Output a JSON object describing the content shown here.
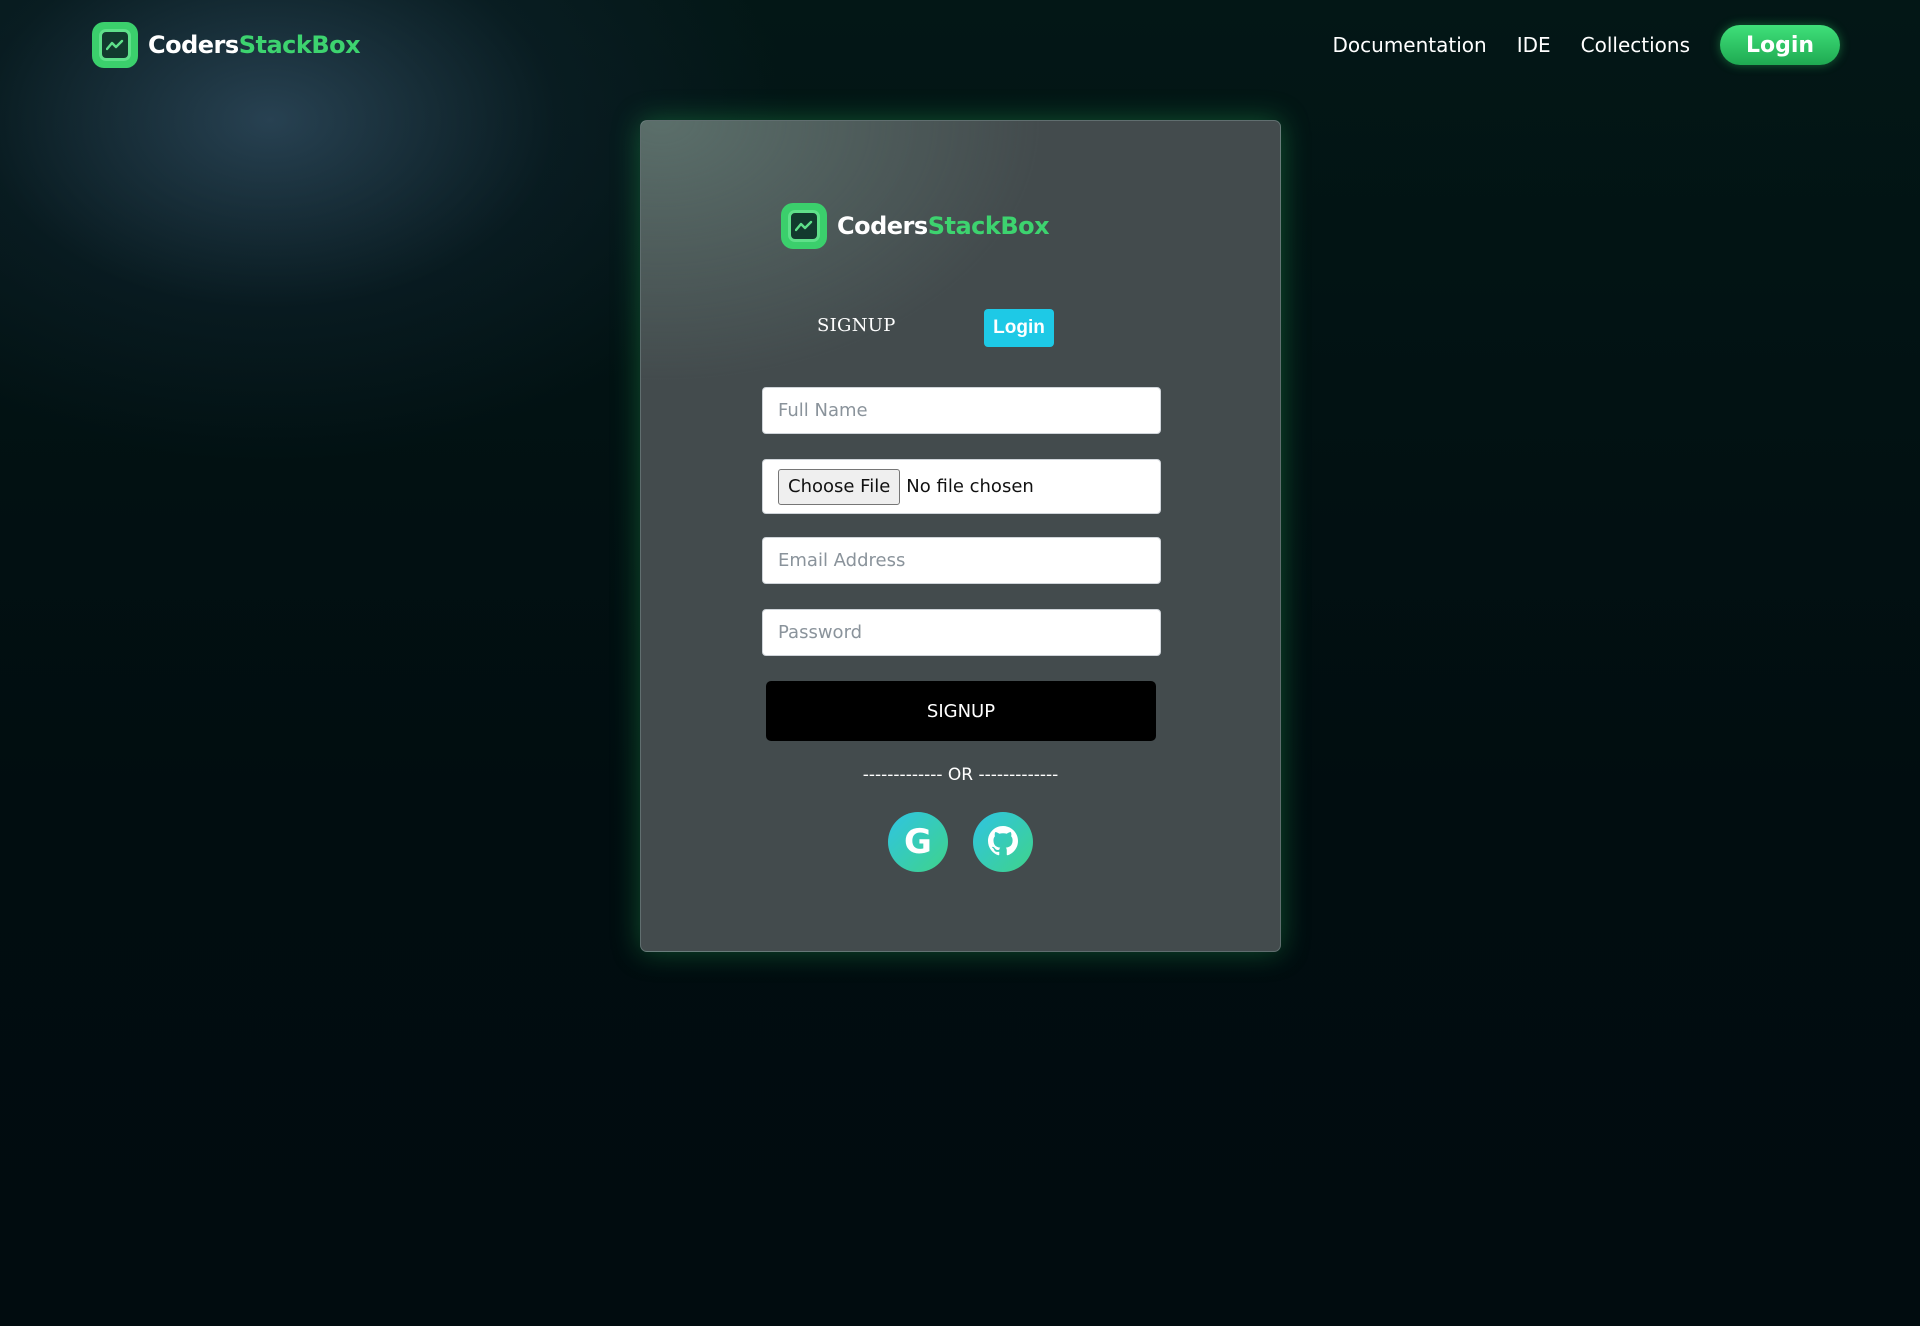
{
  "brand": {
    "name_part1": "Coders",
    "name_part2": "StackBox"
  },
  "nav": {
    "links": [
      "Documentation",
      "IDE",
      "Collections"
    ],
    "login_label": "Login"
  },
  "form": {
    "tab_signup": "SIGNUP",
    "tab_login": "Login",
    "full_name_placeholder": "Full Name",
    "file_button": "Choose File",
    "file_status": "No file chosen",
    "email_placeholder": "Email Address",
    "password_placeholder": "Password",
    "submit_label": "SIGNUP",
    "or_divider": "------------- OR -------------",
    "social": {
      "google_glyph": "G"
    }
  },
  "icons": {
    "logo": "logo-icon",
    "google": "google-icon",
    "github": "github-icon"
  },
  "colors": {
    "brand_green": "#3dd36f",
    "login_tab_cyan": "#1ec9e6",
    "card_bg": "#434b4d",
    "page_bg": "#010d10"
  }
}
